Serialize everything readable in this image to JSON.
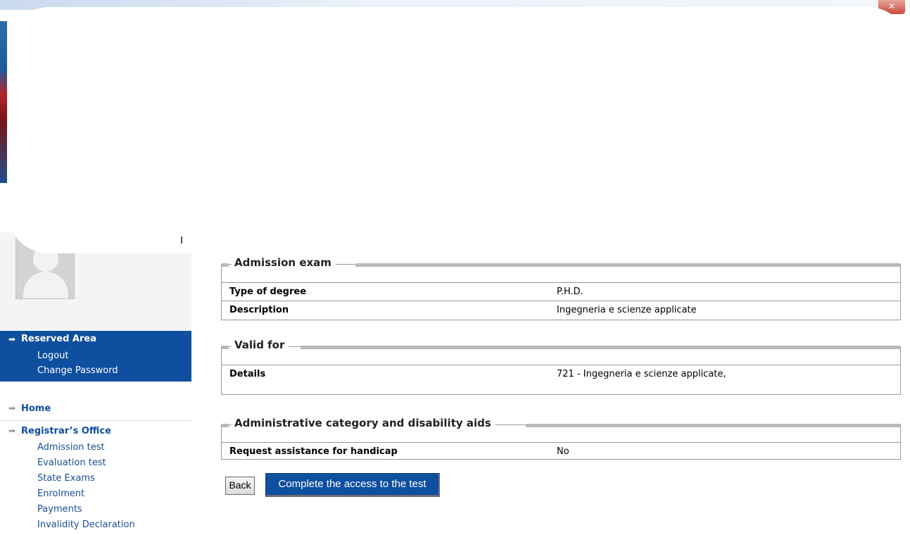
{
  "window": {
    "close_glyph": "✕"
  },
  "sidebar": {
    "avatar_icon": "user-avatar-placeholder",
    "reserved_area": {
      "title": "Reserved Area",
      "links": [
        "Logout",
        "Change Password"
      ]
    },
    "home_label": "Home",
    "registrar": {
      "title": "Registrar’s Office",
      "links": [
        "Admission test",
        "Evaluation test",
        "State Exams",
        "Enrolment",
        "Payments",
        "Invalidity Declaration"
      ]
    },
    "arrow_glyph": "➡"
  },
  "sections": {
    "admission": {
      "title": "Admission exam",
      "rows": [
        {
          "key": "Type of degree",
          "value": "P.H.D."
        },
        {
          "key": "Description",
          "value": "Ingegneria e scienze applicate"
        }
      ]
    },
    "valid_for": {
      "title": "Valid for",
      "rows": [
        {
          "key": "Details",
          "value": "721 - Ingegneria e scienze applicate,"
        }
      ]
    },
    "admin_category": {
      "title": "Administrative category and disability aids",
      "rows": [
        {
          "key": "Request assistance for handicap",
          "value": "No"
        }
      ]
    }
  },
  "buttons": {
    "back": "Back",
    "complete": "Complete the access to the test"
  },
  "colors": {
    "primary": "#0f4f9f",
    "link": "#1a4f90",
    "section_bar": "#b9b9b9"
  }
}
